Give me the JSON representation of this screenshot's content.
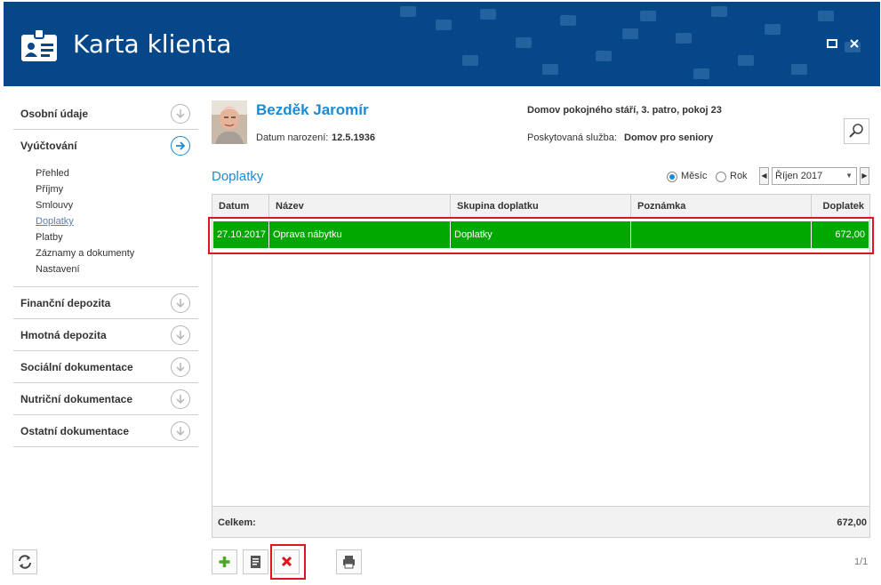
{
  "window": {
    "title": "Karta klienta"
  },
  "client": {
    "name": "Bezděk Jaromír",
    "dob_label": "Datum narození:",
    "dob_value": "12.5.1936",
    "address": "Domov pokojného stáří, 3. patro, pokoj 23",
    "service_label": "Poskytovaná služba:",
    "service_value": "Domov pro seniory"
  },
  "sidebar": {
    "sections": [
      {
        "label": "Osobní údaje",
        "icon": "arrow-down-circle-icon"
      },
      {
        "label": "Vyúčtování",
        "icon": "arrow-right-circle-icon",
        "active": true,
        "items": [
          "Přehled",
          "Příjmy",
          "Smlouvy",
          "Doplatky",
          "Platby",
          "Záznamy a dokumenty",
          "Nastavení"
        ],
        "selected": "Doplatky"
      },
      {
        "label": "Finanční depozita",
        "icon": "arrow-down-circle-icon"
      },
      {
        "label": "Hmotná depozita",
        "icon": "arrow-down-circle-icon"
      },
      {
        "label": "Sociální dokumentace",
        "icon": "arrow-down-circle-icon"
      },
      {
        "label": "Nutriční dokumentace",
        "icon": "arrow-down-circle-icon"
      },
      {
        "label": "Ostatní dokumentace",
        "icon": "arrow-down-circle-icon"
      }
    ]
  },
  "main": {
    "section_title": "Doplatky",
    "period": {
      "mode_options": [
        "Měsíc",
        "Rok"
      ],
      "mode_selected": "Měsíc",
      "value": "Říjen 2017"
    },
    "table": {
      "columns": [
        "Datum",
        "Název",
        "Skupina doplatku",
        "Poznámka",
        "Doplatek"
      ],
      "rows": [
        [
          "27.10.2017",
          "Oprava nábytku",
          "Doplatky",
          "",
          "672,00"
        ]
      ],
      "total_label": "Celkem:",
      "total_value": "672,00"
    },
    "pager": "1/1"
  },
  "colors": {
    "header_bg": "#06478a",
    "accent": "#1a8bd6",
    "selected_row": "#00a800",
    "highlight_border": "#e0141e"
  }
}
